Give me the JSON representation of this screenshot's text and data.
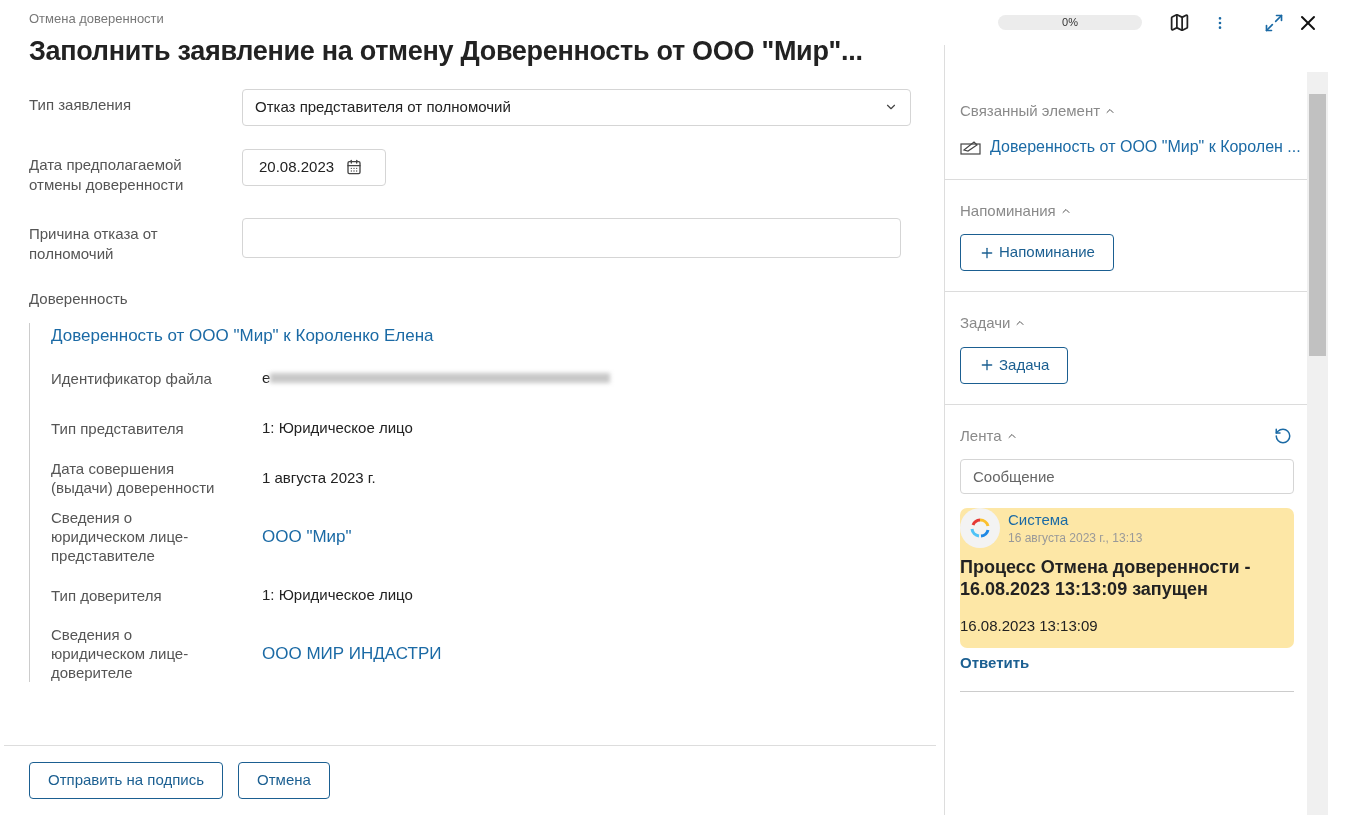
{
  "breadcrumb": "Отмена доверенности",
  "title": "Заполнить заявление на отмену Доверенность от ООО \"Мир\"...",
  "progress": {
    "level": 0,
    "reading": "0%"
  },
  "form": [
    {
      "kind": "select",
      "label": "Тип заявления",
      "value": "Отказ представителя от полномочий"
    },
    {
      "kind": "date",
      "label": "Дата предполагаемой отмены доверенности",
      "value": "20.08.2023"
    },
    {
      "kind": "text",
      "label": "Причина отказа от полномочий"
    }
  ],
  "attorney": {
    "label": "Доверенность",
    "link": "Доверенность от ООО \"Мир\" к Короленко Елена",
    "fields": [
      {
        "kind": "redacted",
        "label": "Идентификатор файла",
        "value": "е"
      },
      {
        "kind": "text",
        "label": "Тип представителя",
        "value": "1: Юридическое лицо"
      },
      {
        "kind": "text",
        "label": "Дата совершения (выдачи) доверенности",
        "value": "1 августа 2023 г."
      },
      {
        "kind": "link",
        "label": "Сведения о юридическом лице-представителе",
        "value": "ООО \"Мир\""
      },
      {
        "kind": "text",
        "label": "Тип доверителя",
        "value": "1: Юридическое лицо"
      },
      {
        "kind": "link",
        "label": "Сведения о юридическом лице-доверителе",
        "value": "ООО МИР ИНДАСТРИ"
      }
    ]
  },
  "buttons": [
    {
      "label": "Отправить на подпись"
    },
    {
      "label": "Отмена"
    }
  ],
  "side": {
    "related": {
      "title": "Связанный элемент",
      "link": "Доверенность от ООО \"Мир\" к Королен ..."
    },
    "reminders": {
      "title": "Напоминания",
      "button": "Напоминание"
    },
    "tasks": {
      "title": "Задачи",
      "button": "Задача"
    },
    "feed": {
      "title": "Лента",
      "placeholder": "Сообщение",
      "post": {
        "author": "Система",
        "time": "16 августа 2023 г., 13:13",
        "headline": "Процесс Отмена доверенности - 16.08.2023 13:13:09 запущен",
        "body": "16.08.2023 13:13:09",
        "reply": "Ответить"
      }
    }
  }
}
